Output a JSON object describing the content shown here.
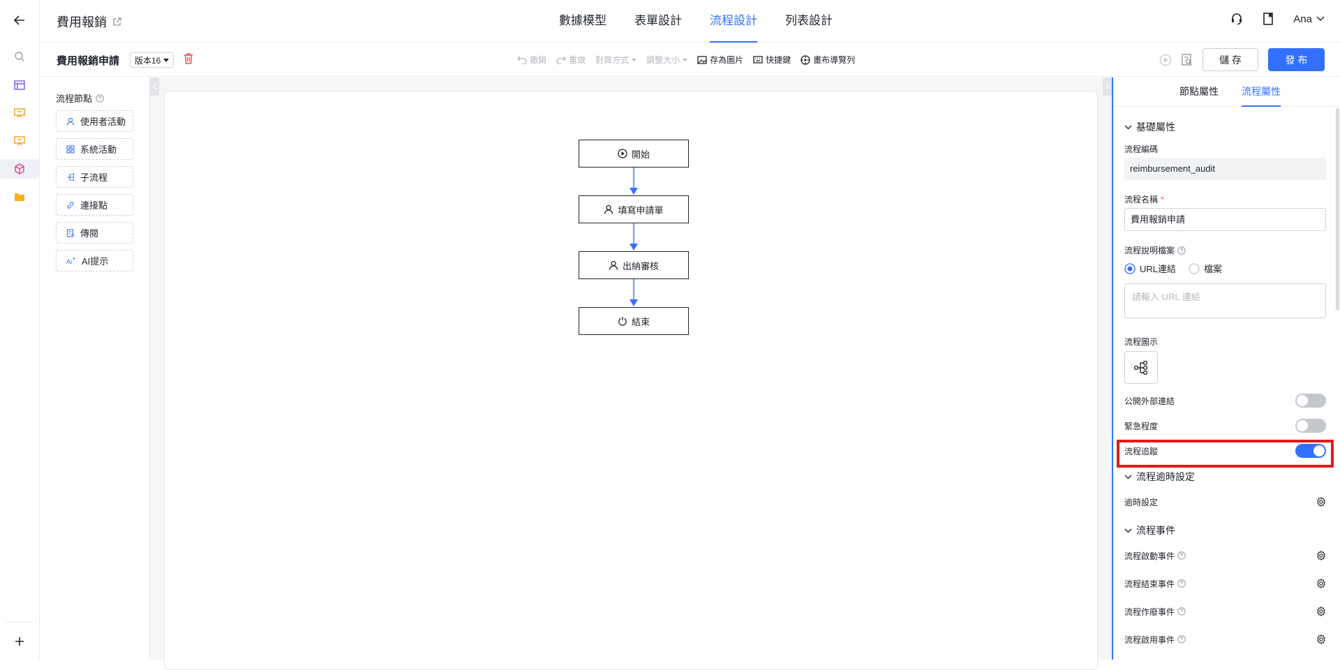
{
  "app": {
    "title": "費用報銷",
    "user": "Ana"
  },
  "main_tabs": [
    {
      "label": "數據模型",
      "active": false
    },
    {
      "label": "表單設計",
      "active": false
    },
    {
      "label": "流程設計",
      "active": true
    },
    {
      "label": "列表設計",
      "active": false
    }
  ],
  "toolbar": {
    "flow_name": "費用報銷申請",
    "version": "版本16",
    "undo": "撤銷",
    "redo": "重做",
    "align": "對齊方式",
    "resize": "調整大小",
    "save_image": "存為圖片",
    "shortcuts": "快捷鍵",
    "canvas_nav": "畫布導覽列",
    "save_label": "儲 存",
    "publish_label": "發 布"
  },
  "palette": {
    "title": "流程節點",
    "items": [
      {
        "label": "使用者活動",
        "icon": "user-icon"
      },
      {
        "label": "系統活動",
        "icon": "grid-icon"
      },
      {
        "label": "子流程",
        "icon": "subflow-icon"
      },
      {
        "label": "連接點",
        "icon": "link-icon"
      },
      {
        "label": "傳閱",
        "icon": "circulate-icon"
      },
      {
        "label": "AI提示",
        "icon": "ai-icon"
      }
    ]
  },
  "flow": {
    "nodes": [
      {
        "label": "開始",
        "icon": "play-circle-icon"
      },
      {
        "label": "填寫申請單",
        "icon": "user-icon"
      },
      {
        "label": "出納審核",
        "icon": "user-icon"
      },
      {
        "label": "結束",
        "icon": "power-icon"
      }
    ]
  },
  "panel": {
    "tabs": [
      {
        "label": "節點屬性",
        "active": false
      },
      {
        "label": "流程屬性",
        "active": true
      }
    ],
    "basic_section": "基礎屬性",
    "code_label": "流程編碼",
    "code_value": "reimbursement_audit",
    "name_label": "流程名稱",
    "name_required": "*",
    "name_value": "費用報銷申請",
    "doc_label": "流程說明檔案",
    "doc_option_url": "URL連結",
    "doc_option_file": "檔案",
    "doc_placeholder": "請輸入 URL 連結",
    "icon_label": "流程圖示",
    "toggles": [
      {
        "label": "公開外部連結",
        "on": false
      },
      {
        "label": "緊急程度",
        "on": false
      },
      {
        "label": "流程追蹤",
        "on": true
      }
    ],
    "timeout_section": "流程逾時設定",
    "timeout_label": "逾時設定",
    "events_section": "流程事件",
    "events": [
      {
        "label": "流程啟動事件"
      },
      {
        "label": "流程結束事件"
      },
      {
        "label": "流程作廢事件"
      },
      {
        "label": "流程啟用事件"
      }
    ]
  },
  "colors": {
    "accent": "#3370ff",
    "highlight": "#e01b1b",
    "danger": "#f54a45"
  }
}
